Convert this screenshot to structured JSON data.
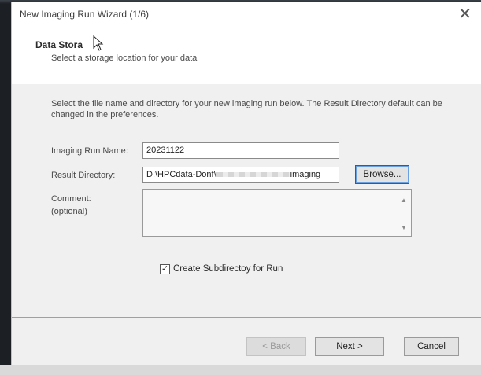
{
  "window": {
    "title": "New Imaging Run Wizard (1/6)",
    "close_glyph": "✕"
  },
  "header": {
    "title": "Data Stora",
    "subtitle": "Select a storage location for your data"
  },
  "description": "Select the file name and directory for your new imaging run below. The Result Directory default can be changed in the preferences.",
  "form": {
    "run_name_label": "Imaging Run Name:",
    "run_name_value": "20231122",
    "result_dir_label": "Result Directory:",
    "result_dir_prefix": "D:\\HPCdata-Donf\\",
    "result_dir_suffix": "imaging",
    "browse_label": "Browse...",
    "comment_label": "Comment:",
    "comment_optional": "(optional)",
    "comment_value": "",
    "subdir_checkbox_label": "Create Subdirectoy for Run",
    "subdir_checked": true
  },
  "scrollbar": {
    "up": "▲",
    "down": "▼"
  },
  "footer": {
    "back_label": "< Back",
    "next_label": "Next >",
    "cancel_label": "Cancel"
  }
}
